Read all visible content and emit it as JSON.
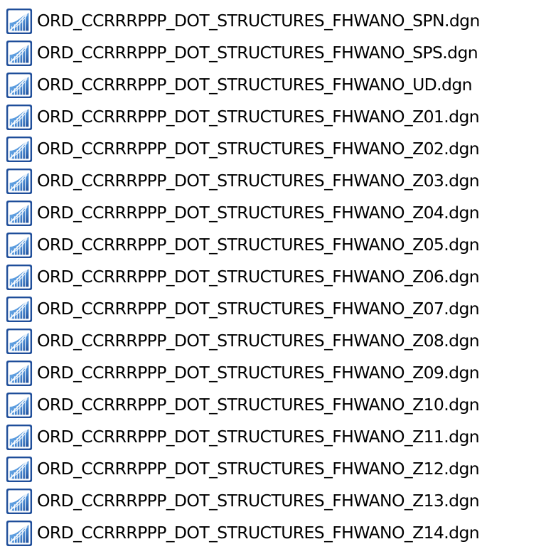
{
  "explorer": {
    "files": [
      {
        "name": "ORD_CCRRRPPP_DOT_STRUCTURES_FHWANO_SPN.dgn",
        "icon": "microstation-dgn-icon"
      },
      {
        "name": "ORD_CCRRRPPP_DOT_STRUCTURES_FHWANO_SPS.dgn",
        "icon": "microstation-dgn-icon"
      },
      {
        "name": "ORD_CCRRRPPP_DOT_STRUCTURES_FHWANO_UD.dgn",
        "icon": "microstation-dgn-icon"
      },
      {
        "name": "ORD_CCRRRPPP_DOT_STRUCTURES_FHWANO_Z01.dgn",
        "icon": "microstation-dgn-icon"
      },
      {
        "name": "ORD_CCRRRPPP_DOT_STRUCTURES_FHWANO_Z02.dgn",
        "icon": "microstation-dgn-icon"
      },
      {
        "name": "ORD_CCRRRPPP_DOT_STRUCTURES_FHWANO_Z03.dgn",
        "icon": "microstation-dgn-icon"
      },
      {
        "name": "ORD_CCRRRPPP_DOT_STRUCTURES_FHWANO_Z04.dgn",
        "icon": "microstation-dgn-icon"
      },
      {
        "name": "ORD_CCRRRPPP_DOT_STRUCTURES_FHWANO_Z05.dgn",
        "icon": "microstation-dgn-icon"
      },
      {
        "name": "ORD_CCRRRPPP_DOT_STRUCTURES_FHWANO_Z06.dgn",
        "icon": "microstation-dgn-icon"
      },
      {
        "name": "ORD_CCRRRPPP_DOT_STRUCTURES_FHWANO_Z07.dgn",
        "icon": "microstation-dgn-icon"
      },
      {
        "name": "ORD_CCRRRPPP_DOT_STRUCTURES_FHWANO_Z08.dgn",
        "icon": "microstation-dgn-icon"
      },
      {
        "name": "ORD_CCRRRPPP_DOT_STRUCTURES_FHWANO_Z09.dgn",
        "icon": "microstation-dgn-icon"
      },
      {
        "name": "ORD_CCRRRPPP_DOT_STRUCTURES_FHWANO_Z10.dgn",
        "icon": "microstation-dgn-icon"
      },
      {
        "name": "ORD_CCRRRPPP_DOT_STRUCTURES_FHWANO_Z11.dgn",
        "icon": "microstation-dgn-icon"
      },
      {
        "name": "ORD_CCRRRPPP_DOT_STRUCTURES_FHWANO_Z12.dgn",
        "icon": "microstation-dgn-icon"
      },
      {
        "name": "ORD_CCRRRPPP_DOT_STRUCTURES_FHWANO_Z13.dgn",
        "icon": "microstation-dgn-icon"
      },
      {
        "name": "ORD_CCRRRPPP_DOT_STRUCTURES_FHWANO_Z14.dgn",
        "icon": "microstation-dgn-icon"
      }
    ]
  },
  "colors": {
    "icon_dark_blue": "#1f4e9a",
    "icon_light_blue": "#6aa8e6",
    "text": "#000000",
    "background": "#ffffff"
  }
}
